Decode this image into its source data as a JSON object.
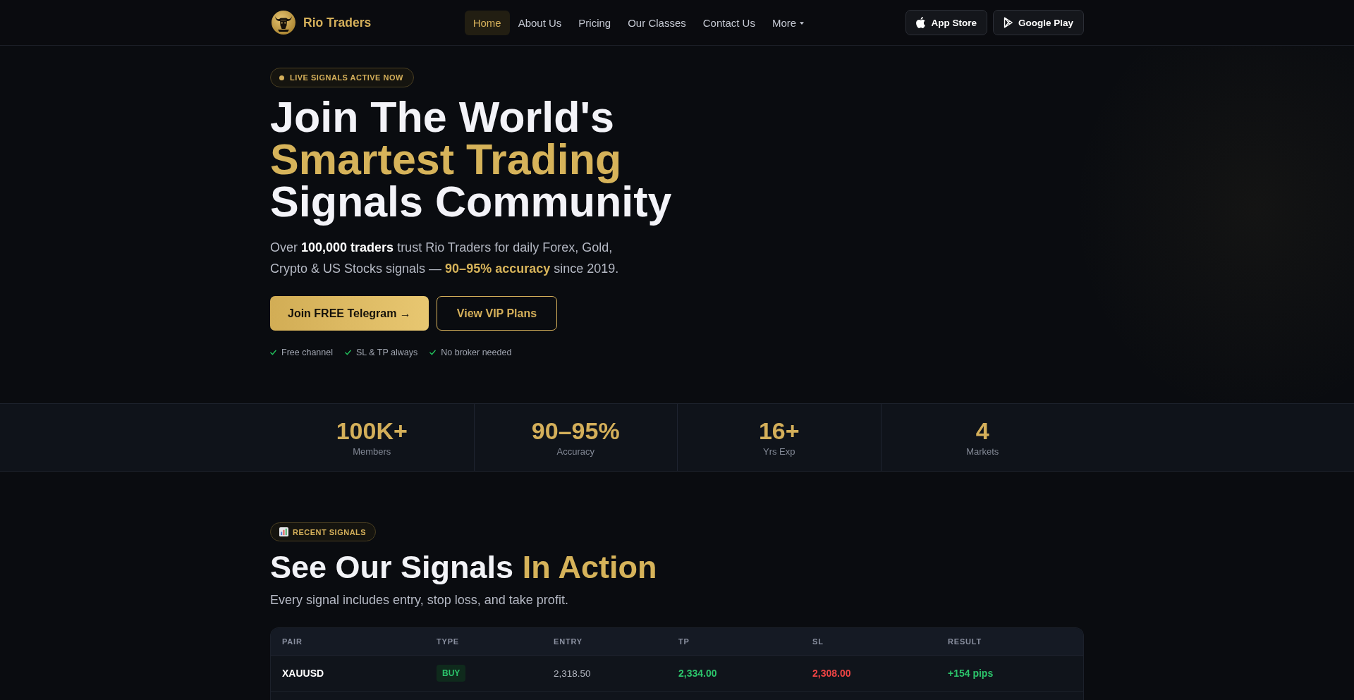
{
  "nav": {
    "brand": "Rio Traders",
    "links": [
      {
        "label": "Home",
        "selected": true,
        "kind": "link"
      },
      {
        "label": "About Us",
        "selected": false,
        "kind": "link"
      },
      {
        "label": "Pricing",
        "selected": false,
        "kind": "link"
      },
      {
        "label": "Our Classes",
        "selected": false,
        "kind": "link"
      },
      {
        "label": "Contact Us",
        "selected": false,
        "kind": "link"
      },
      {
        "label": "More",
        "selected": false,
        "kind": "dropdown"
      }
    ],
    "store_buttons": [
      {
        "label": "App Store",
        "kind": "apple"
      },
      {
        "label": "Google Play",
        "kind": "play"
      }
    ]
  },
  "hero": {
    "badge": "LIVE SIGNALS ACTIVE NOW",
    "heading": [
      {
        "text": "Join The World's",
        "kind": "plain"
      },
      {
        "text": "Smartest Trading",
        "kind": "accent"
      },
      {
        "text": "Signals Community",
        "kind": "plain"
      }
    ],
    "subtitle": [
      {
        "text": "Over ",
        "kind": "plain"
      },
      {
        "text": "100,000 traders",
        "kind": "strong"
      },
      {
        "text": " trust Rio Traders for daily Forex, Gold, Crypto & US Stocks signals — ",
        "kind": "plain"
      },
      {
        "text": "90–95% accuracy",
        "kind": "accent"
      },
      {
        "text": " since 2019.",
        "kind": "plain"
      }
    ],
    "buttons": [
      {
        "label": "Join FREE Telegram →",
        "kind": "primary"
      },
      {
        "label": "View VIP Plans",
        "kind": "outline"
      }
    ],
    "features": [
      "Free channel",
      "SL & TP always",
      "No broker needed"
    ]
  },
  "stats": [
    {
      "value": "100K+",
      "label": "Members"
    },
    {
      "value": "90–95%",
      "label": "Accuracy"
    },
    {
      "value": "16+",
      "label": "Yrs Exp"
    },
    {
      "value": "4",
      "label": "Markets"
    }
  ],
  "signals": {
    "badge": "RECENT SIGNALS",
    "heading": [
      {
        "text": "See Our Signals",
        "kind": "plain"
      },
      {
        "text": "In Action",
        "kind": "accent"
      }
    ],
    "subtitle": "Every signal includes entry, stop loss, and take profit.",
    "table": {
      "columns": [
        "PAIR",
        "TYPE",
        "ENTRY",
        "TP",
        "SL",
        "RESULT"
      ],
      "rows": [
        {
          "pair": "XAUUSD",
          "type": "BUY",
          "entry": "2,318.50",
          "tp": "2,334.00",
          "sl": "2,308.00",
          "result": "+154 pips"
        }
      ]
    }
  }
}
